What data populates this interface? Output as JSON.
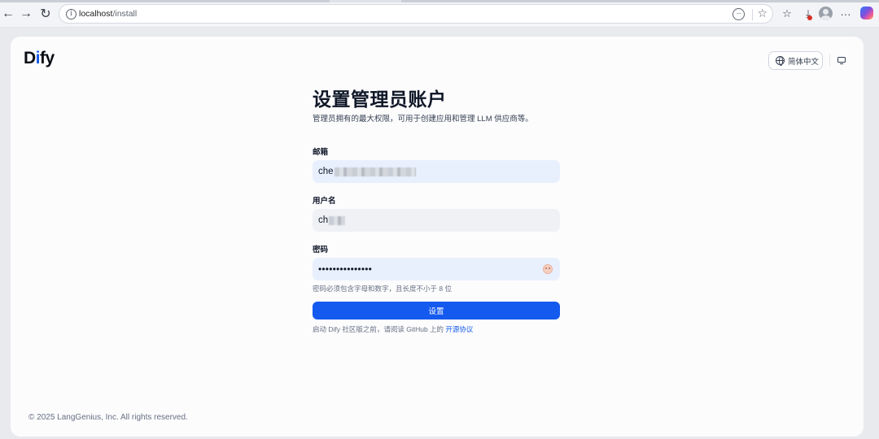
{
  "browser": {
    "url_host": "localhost",
    "url_path": "/install"
  },
  "header": {
    "logo_part1": "D",
    "logo_part2": "i",
    "logo_part3": "fy",
    "language_label": "简体中文"
  },
  "form": {
    "title": "设置管理员账户",
    "subtitle": "管理员拥有的最大权限，可用于创建应用和管理 LLM 供应商等。",
    "email_label": "邮箱",
    "email_value_visible": "che",
    "username_label": "用户名",
    "username_value_visible": "ch",
    "password_label": "密码",
    "password_value": "•••••••••••••••",
    "password_hint": "密码必须包含字母和数字，且长度不小于 8 位",
    "submit_label": "设置",
    "agree_text": "启动 Dify 社区版之前，请阅读 GitHub 上的",
    "agree_link": "开源协议"
  },
  "footer": {
    "copyright": "© 2025 LangGenius, Inc. All rights reserved."
  },
  "colors": {
    "accent": "#155aef",
    "input_filled": "#e8f0fe",
    "input_default": "#eff1f4",
    "page_bg": "#fcfcfd"
  }
}
